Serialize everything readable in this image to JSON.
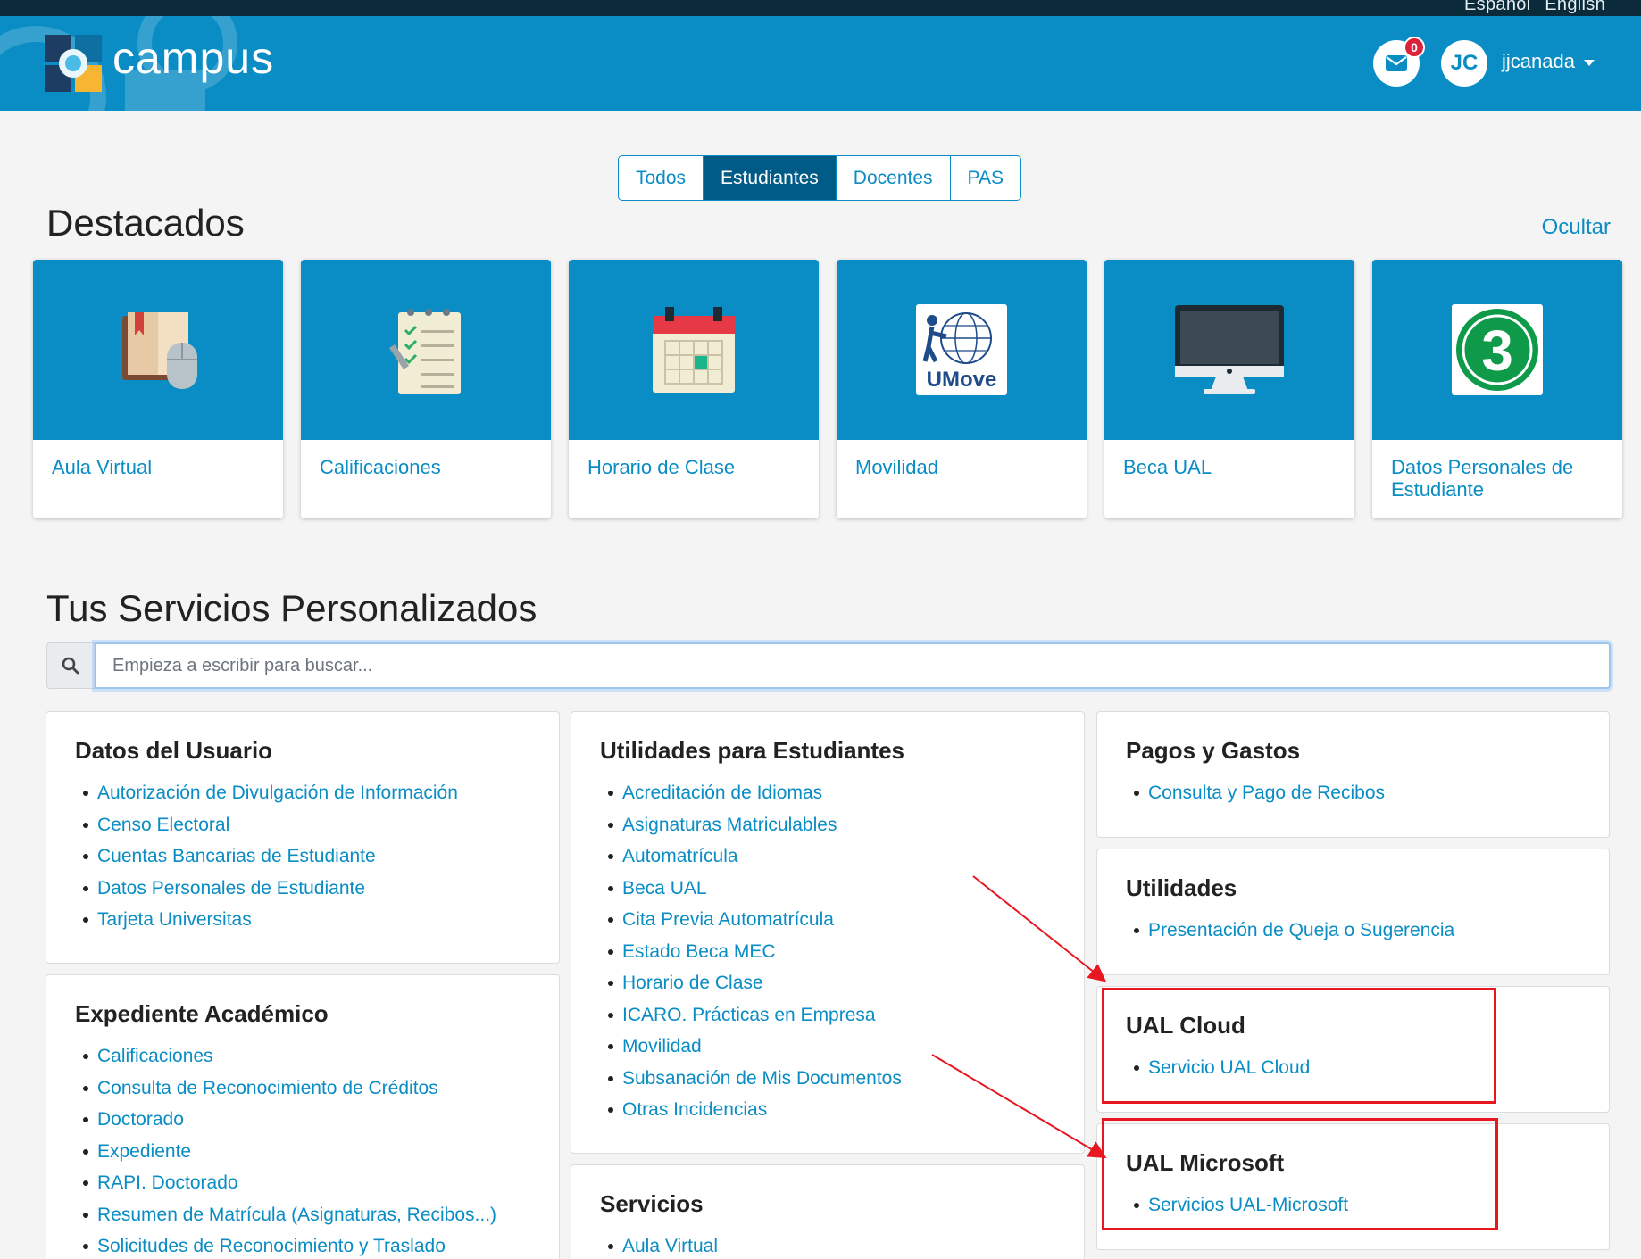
{
  "lang": {
    "es": "Español",
    "en": "English"
  },
  "header": {
    "brand": "campus",
    "mail_count": "0",
    "avatar_initials": "JC",
    "username": "jjcanada"
  },
  "filters": [
    "Todos",
    "Estudiantes",
    "Docentes",
    "PAS"
  ],
  "featured": {
    "title": "Destacados",
    "hide_label": "Ocultar",
    "cards": [
      {
        "label": "Aula Virtual",
        "icon": "book-mouse-icon"
      },
      {
        "label": "Calificaciones",
        "icon": "checklist-icon"
      },
      {
        "label": "Horario de Clase",
        "icon": "calendar-icon"
      },
      {
        "label": "Movilidad",
        "icon": "umove-icon",
        "icon_text": "UMove"
      },
      {
        "label": "Beca UAL",
        "icon": "monitor-icon"
      },
      {
        "label": "Datos Personales de Estudiante",
        "icon": "number-three-icon",
        "icon_text": "3"
      }
    ]
  },
  "services": {
    "title": "Tus Servicios Personalizados",
    "search_placeholder": "Empieza a escribir para buscar...",
    "panels": {
      "datos_usuario": {
        "title": "Datos del Usuario",
        "items": [
          "Autorización de Divulgación de Información",
          "Censo Electoral",
          "Cuentas Bancarias de Estudiante",
          "Datos Personales de Estudiante",
          "Tarjeta Universitas"
        ]
      },
      "expediente": {
        "title": "Expediente Académico",
        "items": [
          "Calificaciones",
          "Consulta de Reconocimiento de Créditos",
          "Doctorado",
          "Expediente",
          "RAPI. Doctorado",
          "Resumen de Matrícula (Asignaturas, Recibos...)",
          "Solicitudes de Reconocimiento y Traslado"
        ]
      },
      "utilidades_estudiantes": {
        "title": "Utilidades para Estudiantes",
        "items": [
          "Acreditación de Idiomas",
          "Asignaturas Matriculables",
          "Automatrícula",
          "Beca UAL",
          "Cita Previa Automatrícula",
          "Estado Beca MEC",
          "Horario de Clase",
          "ICARO. Prácticas en Empresa",
          "Movilidad",
          "Subsanación de Mis Documentos",
          "Otras Incidencias"
        ]
      },
      "servicios": {
        "title": "Servicios",
        "items": [
          "Aula Virtual"
        ]
      },
      "pagos": {
        "title": "Pagos y Gastos",
        "items": [
          "Consulta y Pago de Recibos"
        ]
      },
      "utilidades": {
        "title": "Utilidades",
        "items": [
          "Presentación de Queja o Sugerencia"
        ]
      },
      "ual_cloud": {
        "title": "UAL Cloud",
        "items": [
          "Servicio UAL Cloud"
        ]
      },
      "ual_microsoft": {
        "title": "UAL Microsoft",
        "items": [
          "Servicios UAL-Microsoft"
        ]
      }
    }
  },
  "annotation_color": "#e8161f",
  "brand_color": "#0a8cc4"
}
